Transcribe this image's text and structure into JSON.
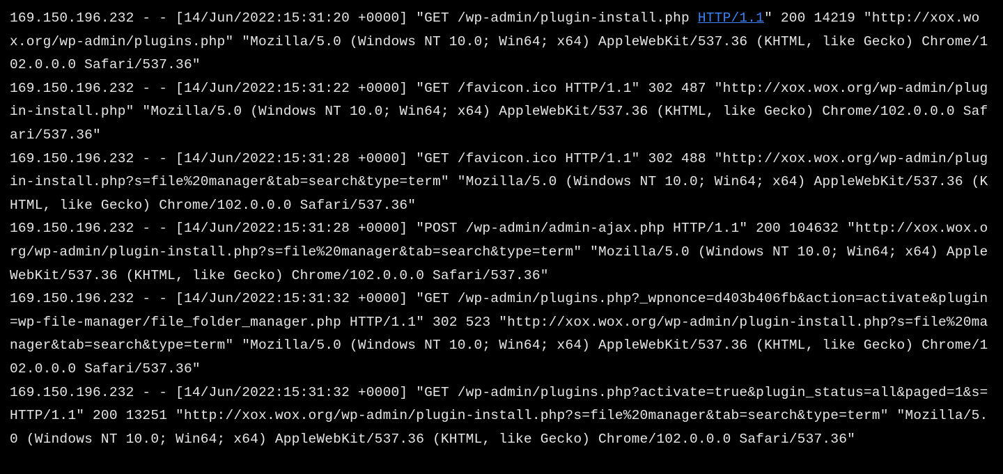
{
  "logs": [
    {
      "pre": "169.150.196.232 - - [14/Jun/2022:15:31:20 +0000] \"GET /wp-admin/plugin-install.php ",
      "link": "HTTP/1.1",
      "post": "\" 200 14219 \"http://xox.wox.org/wp-admin/plugins.php\" \"Mozilla/5.0 (Windows NT 10.0; Win64; x64) AppleWebKit/537.36 (KHTML, like Gecko) Chrome/102.0.0.0 Safari/537.36\""
    },
    {
      "full": "169.150.196.232 - - [14/Jun/2022:15:31:22 +0000] \"GET /favicon.ico HTTP/1.1\" 302 487 \"http://xox.wox.org/wp-admin/plugin-install.php\" \"Mozilla/5.0 (Windows NT 10.0; Win64; x64) AppleWebKit/537.36 (KHTML, like Gecko) Chrome/102.0.0.0 Safari/537.36\""
    },
    {
      "full": "169.150.196.232 - - [14/Jun/2022:15:31:28 +0000] \"GET /favicon.ico HTTP/1.1\" 302 488 \"http://xox.wox.org/wp-admin/plugin-install.php?s=file%20manager&tab=search&type=term\" \"Mozilla/5.0 (Windows NT 10.0; Win64; x64) AppleWebKit/537.36 (KHTML, like Gecko) Chrome/102.0.0.0 Safari/537.36\""
    },
    {
      "full": "169.150.196.232 - - [14/Jun/2022:15:31:28 +0000] \"POST /wp-admin/admin-ajax.php HTTP/1.1\" 200 104632 \"http://xox.wox.org/wp-admin/plugin-install.php?s=file%20manager&tab=search&type=term\" \"Mozilla/5.0 (Windows NT 10.0; Win64; x64) AppleWebKit/537.36 (KHTML, like Gecko) Chrome/102.0.0.0 Safari/537.36\""
    },
    {
      "full": "169.150.196.232 - - [14/Jun/2022:15:31:32 +0000] \"GET /wp-admin/plugins.php?_wpnonce=d403b406fb&action=activate&plugin=wp-file-manager/file_folder_manager.php HTTP/1.1\" 302 523 \"http://xox.wox.org/wp-admin/plugin-install.php?s=file%20manager&tab=search&type=term\" \"Mozilla/5.0 (Windows NT 10.0; Win64; x64) AppleWebKit/537.36 (KHTML, like Gecko) Chrome/102.0.0.0 Safari/537.36\""
    },
    {
      "full": "169.150.196.232 - - [14/Jun/2022:15:31:32 +0000] \"GET /wp-admin/plugins.php?activate=true&plugin_status=all&paged=1&s= HTTP/1.1\" 200 13251 \"http://xox.wox.org/wp-admin/plugin-install.php?s=file%20manager&tab=search&type=term\" \"Mozilla/5.0 (Windows NT 10.0; Win64; x64) AppleWebKit/537.36 (KHTML, like Gecko) Chrome/102.0.0.0 Safari/537.36\""
    }
  ]
}
